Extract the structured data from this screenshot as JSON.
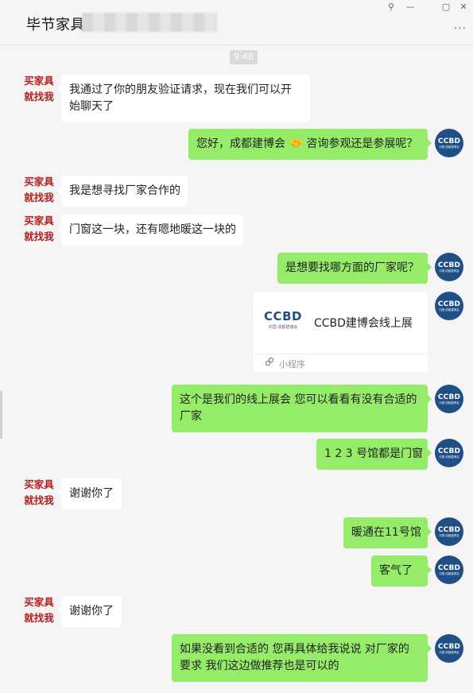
{
  "header": {
    "title": "毕节家具",
    "more_glyph": "···"
  },
  "window_controls": {
    "pin": "⚲",
    "minimize": "—",
    "maximize": "▢",
    "close": "✕"
  },
  "timestamp": "9:48",
  "contact_avatar": {
    "line1": "买家具",
    "line2": "就找我"
  },
  "self_avatar": {
    "logo": "CCBD",
    "caption": "中国·成都建博会"
  },
  "messages": [
    {
      "side": "left",
      "text": "我通过了你的朋友验证请求，现在我们可以开始聊天了"
    },
    {
      "side": "right",
      "text": "您好，成都建博会 🤝 咨询参观还是参展呢？"
    },
    {
      "side": "left",
      "text": "我是想寻找厂家合作的"
    },
    {
      "side": "left",
      "text": "门窗这一块，还有嗯地暖这一块的"
    },
    {
      "side": "right",
      "text": "是想要找哪方面的厂家呢？"
    },
    {
      "side": "right",
      "type": "mini-program"
    },
    {
      "side": "right",
      "text": "这个是我们的线上展会  您可以看看有没有合适的厂家"
    },
    {
      "side": "right",
      "text": "1 2 3 号馆都是门窗"
    },
    {
      "side": "left",
      "text": "谢谢你了"
    },
    {
      "side": "right",
      "text": "暖通在11号馆"
    },
    {
      "side": "right",
      "text": "客气了"
    },
    {
      "side": "left",
      "text": "谢谢你了"
    },
    {
      "side": "right",
      "text": "如果没看到合适的 您再具体给我说说 对厂家的要求  我们这边做推荐也是可以的"
    }
  ],
  "mini_program_card": {
    "logo": "CCBD",
    "logo_caption": "中国·成都建博会",
    "title": "CCBD建博会线上展",
    "footer_icon": "mini-program-icon",
    "footer_label": "小程序"
  },
  "colors": {
    "bubble_self": "#95ec69",
    "bubble_other": "#ffffff",
    "background": "#f5f5f5",
    "contact_avatar_text": "#b41f1f",
    "self_avatar_bg": "#1f4f86"
  }
}
